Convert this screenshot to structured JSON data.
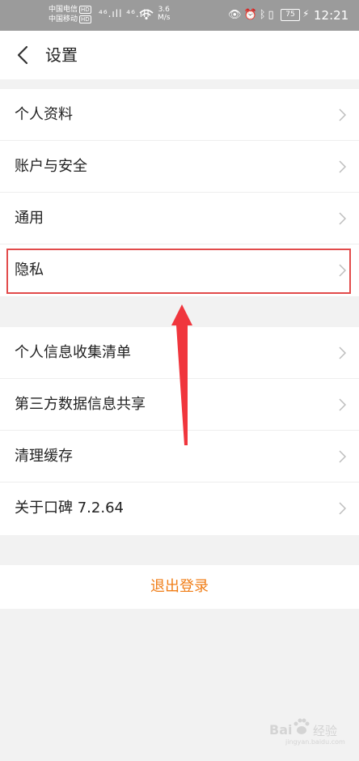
{
  "status_bar": {
    "carrier1": "中国电信",
    "carrier2": "中国移动",
    "hd_badge": "HD",
    "signal_text": "⁴⁶.ıll ⁴⁶.ıll",
    "net_speed_value": "3.6",
    "net_speed_unit": "M/s",
    "icons": [
      "wifi-icon",
      "eye-icon",
      "alarm-icon",
      "bluetooth-icon",
      "vibrate-icon"
    ],
    "battery": "75",
    "time": "12:21"
  },
  "header": {
    "title": "设置"
  },
  "group1": {
    "items": [
      {
        "label": "个人资料"
      },
      {
        "label": "账户与安全"
      },
      {
        "label": "通用"
      },
      {
        "label": "隐私"
      }
    ]
  },
  "group2": {
    "items": [
      {
        "label": "个人信息收集清单"
      },
      {
        "label": "第三方数据信息共享"
      },
      {
        "label": "清理缓存"
      },
      {
        "label": "关于口碑 7.2.64"
      }
    ]
  },
  "logout": {
    "label": "退出登录"
  },
  "annotation": {
    "highlight_color": "#e24b4b",
    "arrow_color": "#f0363d"
  },
  "watermark": {
    "brand": "Bai",
    "brand_cn": "经验",
    "url": "jingyan.baidu.com"
  },
  "colors": {
    "accent": "#f07d16",
    "background": "#f2f2f2",
    "status_bar": "#9b9b9b"
  }
}
